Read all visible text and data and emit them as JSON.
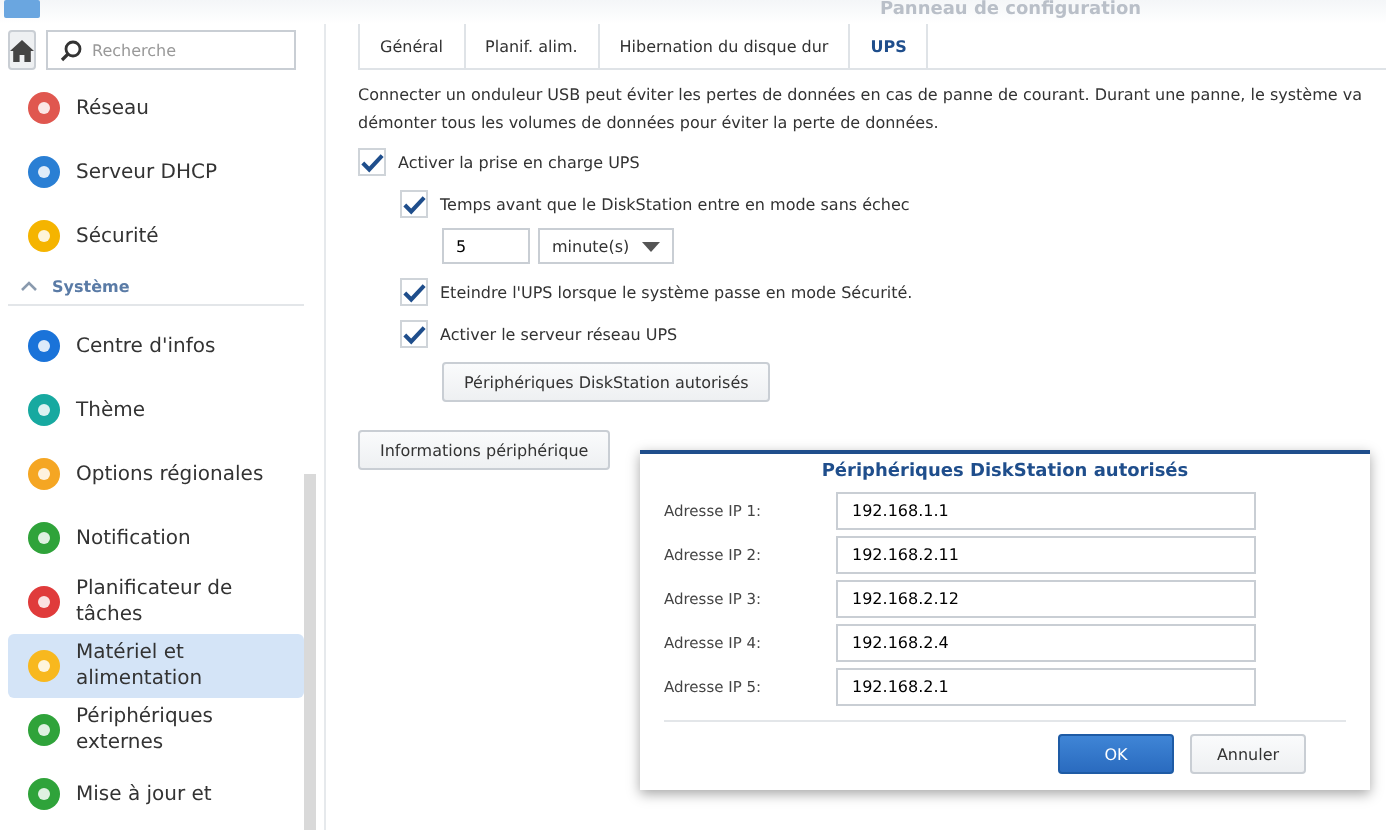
{
  "window": {
    "title": "Panneau de configuration"
  },
  "sidebar": {
    "search": {
      "placeholder": "Recherche"
    },
    "items": [
      {
        "kind": "item",
        "label": "Réseau",
        "selected": false
      },
      {
        "kind": "item",
        "label": "Serveur DHCP",
        "selected": false
      },
      {
        "kind": "item",
        "label": "Sécurité",
        "selected": false
      },
      {
        "kind": "section",
        "label": "Système",
        "expanded": true
      },
      {
        "kind": "item",
        "label": "Centre d'infos",
        "selected": false
      },
      {
        "kind": "item",
        "label": "Thème",
        "selected": false
      },
      {
        "kind": "item",
        "label": "Options régionales",
        "selected": false
      },
      {
        "kind": "item",
        "label": "Notification",
        "selected": false
      },
      {
        "kind": "item",
        "label": "Planificateur de tâches",
        "selected": false
      },
      {
        "kind": "item",
        "label": "Matériel et alimentation",
        "selected": true
      },
      {
        "kind": "item",
        "label": "Périphériques externes",
        "selected": false
      },
      {
        "kind": "item",
        "label": "Mise à jour et",
        "selected": false
      }
    ]
  },
  "tabs": [
    {
      "label": "Général",
      "selected": false
    },
    {
      "label": "Planif. alim.",
      "selected": false
    },
    {
      "label": "Hibernation du disque dur",
      "selected": false
    },
    {
      "label": "UPS",
      "selected": true
    }
  ],
  "intro": [
    "Connecter un onduleur USB peut éviter les pertes de données en cas de panne de courant. Durant une panne, le système va",
    "démonter tous les volumes de données pour éviter la perte de données."
  ],
  "options": [
    {
      "kind": "checkbox",
      "label": "Activer la prise en charge UPS",
      "checked": true,
      "children": [
        {
          "kind": "checkbox",
          "label": "Temps avant que le DiskStation entre en mode sans échec",
          "checked": true
        },
        {
          "kind": "time",
          "value": "5",
          "unit": "minute(s)"
        },
        {
          "kind": "checkbox",
          "label": "Eteindre l'UPS lorsque le système passe en mode Sécurité.",
          "checked": true
        },
        {
          "kind": "checkbox",
          "label": "Activer le serveur réseau UPS",
          "checked": true
        },
        {
          "kind": "button",
          "label": "Périphériques DiskStation autorisés"
        }
      ]
    }
  ],
  "info_button": "Informations périphérique",
  "dialog": {
    "title": "Périphériques DiskStation autorisés",
    "fields": [
      {
        "label": "Adresse IP 1:",
        "value": "192.168.1.1"
      },
      {
        "label": "Adresse IP 2:",
        "value": "192.168.2.11"
      },
      {
        "label": "Adresse IP 3:",
        "value": "192.168.2.12"
      },
      {
        "label": "Adresse IP 4:",
        "value": "192.168.2.4"
      },
      {
        "label": "Adresse IP 5:",
        "value": "192.168.2.1"
      }
    ],
    "ok": "OK",
    "cancel": "Annuler"
  }
}
